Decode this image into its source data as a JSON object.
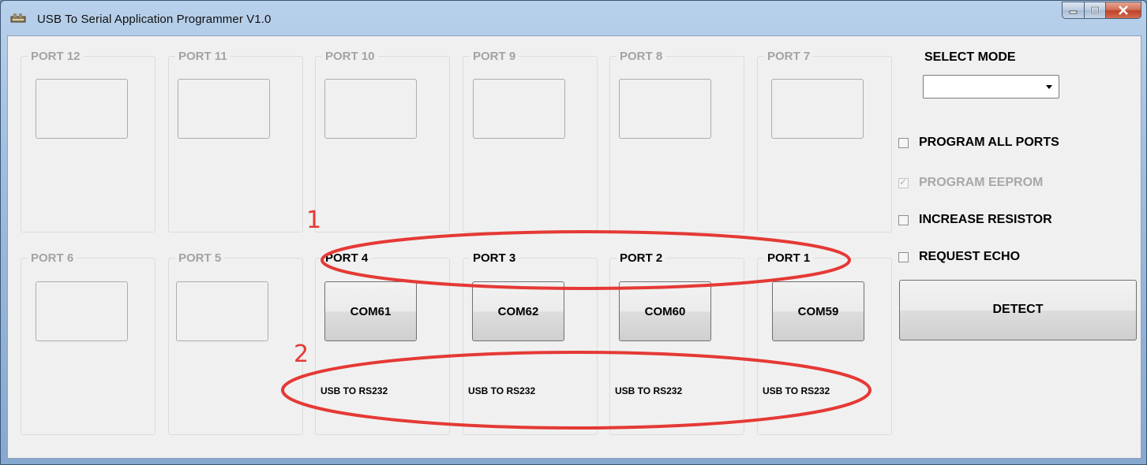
{
  "window": {
    "title": "USB To Serial Application Programmer V1.0",
    "icon": "usb-serial-app-icon",
    "controls": [
      "minimize",
      "maximize",
      "close"
    ]
  },
  "ports": [
    {
      "id": "port12",
      "label": "PORT 12",
      "active": false,
      "com": "",
      "type": ""
    },
    {
      "id": "port11",
      "label": "PORT 11",
      "active": false,
      "com": "",
      "type": ""
    },
    {
      "id": "port10",
      "label": "PORT 10",
      "active": false,
      "com": "",
      "type": ""
    },
    {
      "id": "port9",
      "label": "PORT 9",
      "active": false,
      "com": "",
      "type": ""
    },
    {
      "id": "port8",
      "label": "PORT 8",
      "active": false,
      "com": "",
      "type": ""
    },
    {
      "id": "port7",
      "label": "PORT 7",
      "active": false,
      "com": "",
      "type": ""
    },
    {
      "id": "port6",
      "label": "PORT 6",
      "active": false,
      "com": "",
      "type": ""
    },
    {
      "id": "port5",
      "label": "PORT 5",
      "active": false,
      "com": "",
      "type": ""
    },
    {
      "id": "port4",
      "label": "PORT 4",
      "active": true,
      "com": "COM61",
      "type": "USB TO RS232"
    },
    {
      "id": "port3",
      "label": "PORT 3",
      "active": true,
      "com": "COM62",
      "type": "USB TO RS232"
    },
    {
      "id": "port2",
      "label": "PORT 2",
      "active": true,
      "com": "COM60",
      "type": "USB TO RS232"
    },
    {
      "id": "port1",
      "label": "PORT 1",
      "active": true,
      "com": "COM59",
      "type": "USB TO RS232"
    }
  ],
  "mode": {
    "label": "SELECT MODE",
    "value": ""
  },
  "options": [
    {
      "id": "program-all-ports",
      "label": "PROGRAM ALL PORTS",
      "checked": false,
      "enabled": true
    },
    {
      "id": "program-eeprom",
      "label": "PROGRAM EEPROM",
      "checked": true,
      "enabled": false
    },
    {
      "id": "increase-resistor",
      "label": "INCREASE RESISTOR",
      "checked": false,
      "enabled": true
    },
    {
      "id": "request-echo",
      "label": "REQUEST ECHO",
      "checked": false,
      "enabled": true
    }
  ],
  "detect": {
    "label": "DETECT"
  },
  "annotations": [
    {
      "label": "1",
      "color": "#e53935"
    },
    {
      "label": "2",
      "color": "#e53935"
    }
  ],
  "colors": {
    "disabled_text": "#a3a3a3",
    "annotation": "#e53935"
  }
}
